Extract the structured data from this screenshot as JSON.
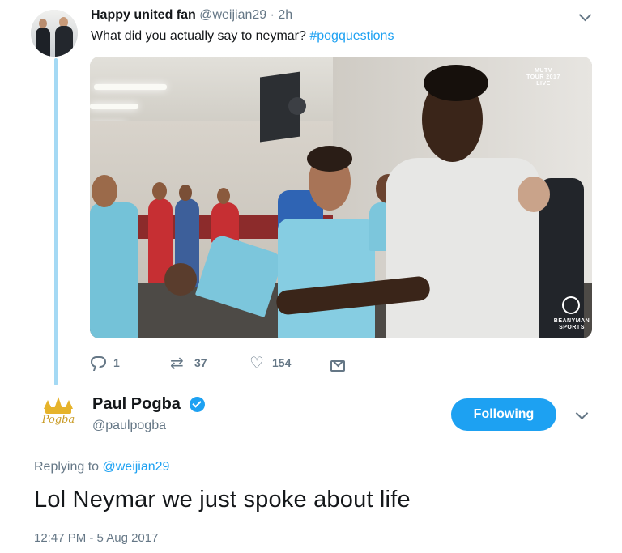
{
  "parent_tweet": {
    "display_name": "Happy united fan",
    "handle": "@weijian29",
    "separator": " · ",
    "time": "2h",
    "text": "What did you actually say to neymar? ",
    "hashtag": "#pogquestions",
    "media": {
      "watermark_top": "MUTV\nTOUR 2017\nLIVE",
      "watermark_bottom": "BEANYMAN\nSPORTS"
    },
    "actions": {
      "replies": "1",
      "retweets": "37",
      "likes": "154"
    },
    "icons": {
      "reply": "reply-icon",
      "retweet": "retweet-icon",
      "like": "heart-icon",
      "dm": "envelope-icon",
      "menu": "chevron-down-icon"
    }
  },
  "reply_tweet": {
    "display_name": "Paul Pogba",
    "handle": "@paulpogba",
    "avatar_text": "Pogba",
    "follow_button_label": "Following",
    "replying_to_prefix": "Replying to ",
    "replying_to_handle": "@weijian29",
    "text": "Lol Neymar we just spoke about life",
    "timestamp": "12:47 PM - 5 Aug 2017"
  },
  "colors": {
    "accent": "#1da1f2",
    "muted": "#657786",
    "thread_line": "#a4d9f4",
    "avatar_gold": "#e6b32b"
  }
}
